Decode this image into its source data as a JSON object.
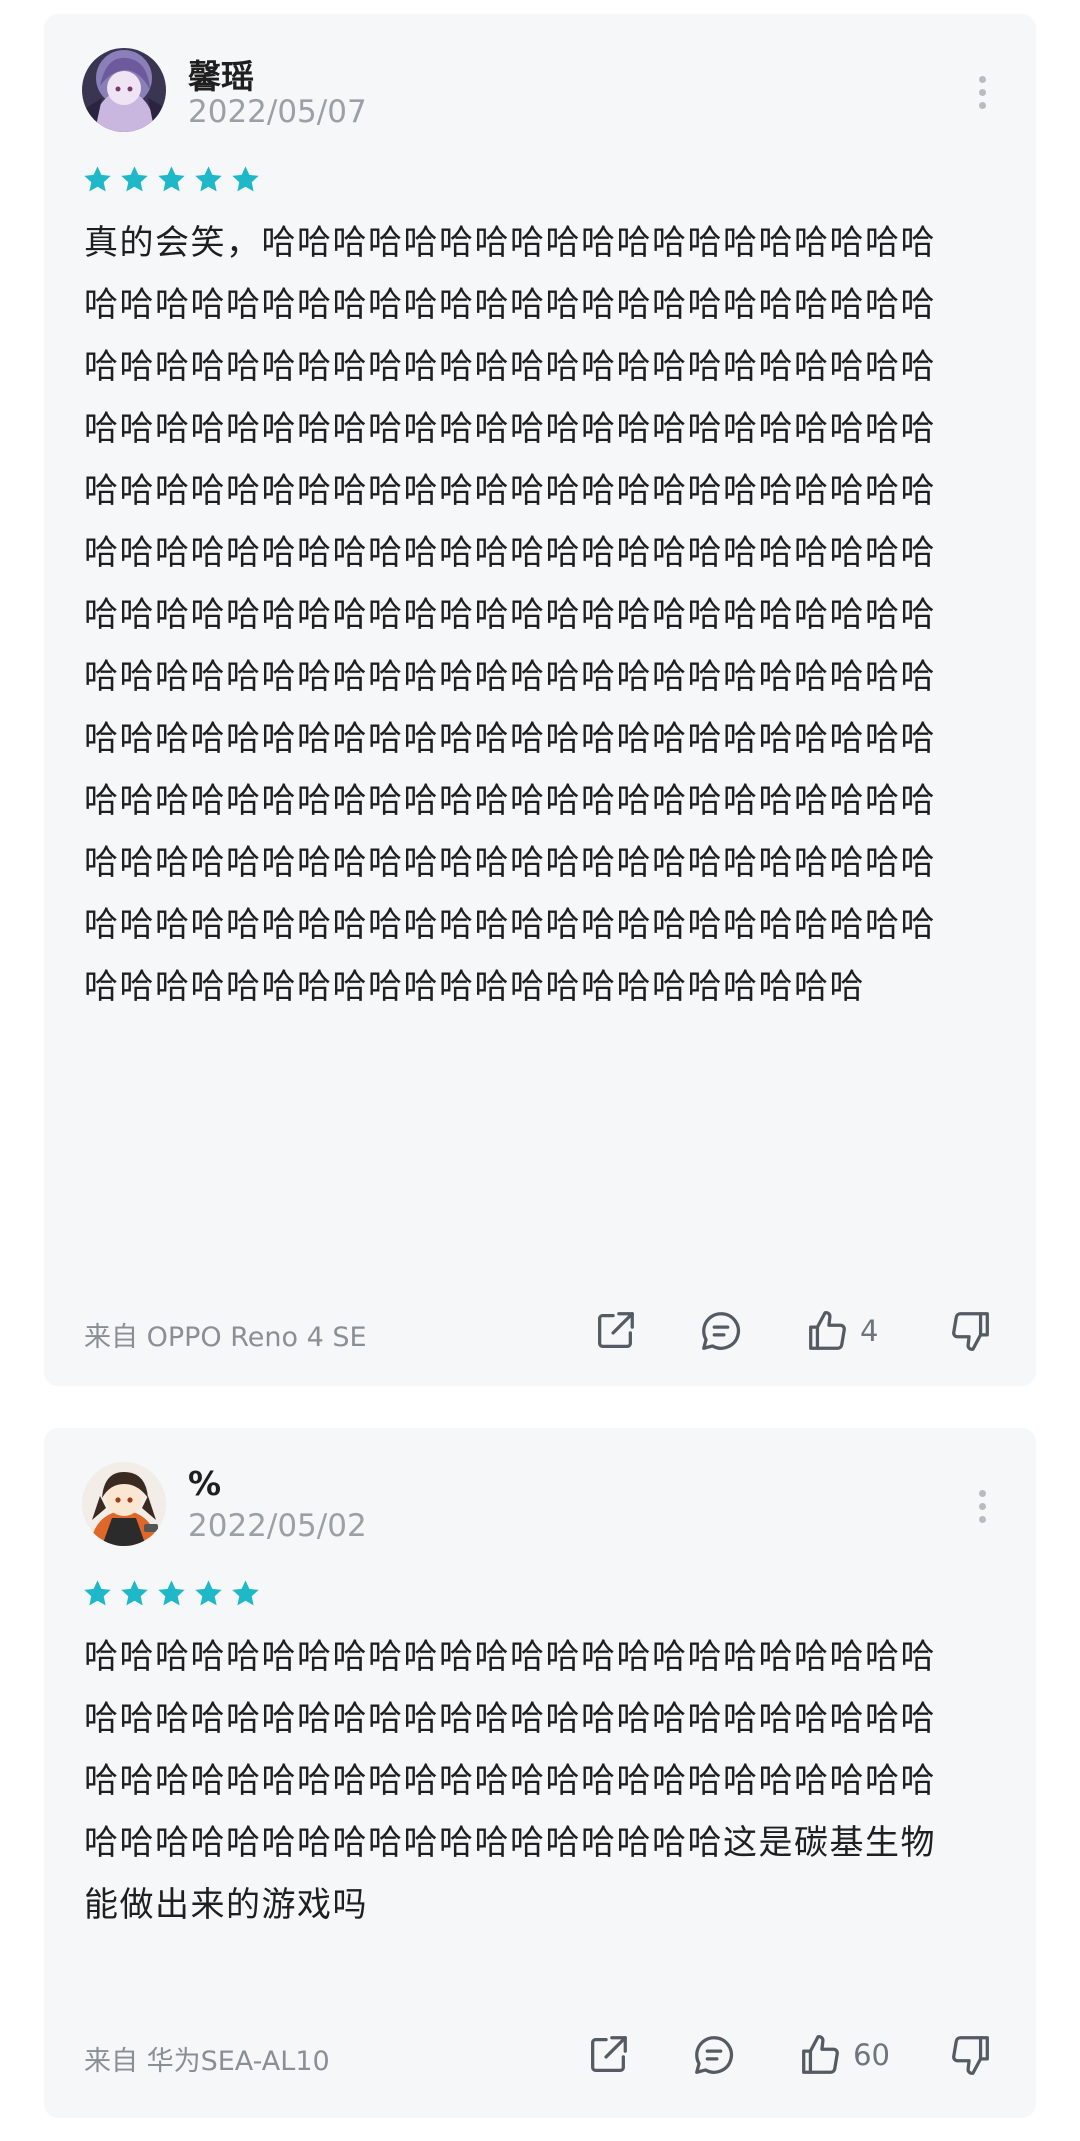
{
  "colors": {
    "card_bg": "#f5f7f9",
    "star": "#1fb8c9",
    "icon": "#555b62",
    "muted_text": "#9aa0a6"
  },
  "reviews": [
    {
      "username": "馨瑶",
      "date": "2022/05/07",
      "rating": 5,
      "text": "真的会笑，哈哈哈哈哈哈哈哈哈哈哈哈哈哈哈哈哈哈哈哈哈哈哈哈哈哈哈哈哈哈哈哈哈哈哈哈哈哈哈哈哈哈哈哈哈哈哈哈哈哈哈哈哈哈哈哈哈哈哈哈哈哈哈哈哈哈哈哈哈哈哈哈哈哈哈哈哈哈哈哈哈哈哈哈哈哈哈哈哈哈哈哈哈哈哈哈哈哈哈哈哈哈哈哈哈哈哈哈哈哈哈哈哈哈哈哈哈哈哈哈哈哈哈哈哈哈哈哈哈哈哈哈哈哈哈哈哈哈哈哈哈哈哈哈哈哈哈哈哈哈哈哈哈哈哈哈哈哈哈哈哈哈哈哈哈哈哈哈哈哈哈哈哈哈哈哈哈哈哈哈哈哈哈哈哈哈哈哈哈哈哈哈哈哈哈哈哈哈哈哈哈哈哈哈哈哈哈哈哈哈哈哈哈哈哈哈哈哈哈哈哈哈哈哈哈哈哈哈哈哈哈哈哈哈哈哈哈哈哈哈哈哈哈哈哈哈哈哈哈哈哈哈哈哈哈哈哈哈哈哈哈哈哈哈哈哈哈哈哈哈哈哈哈哈哈哈哈哈哈哈哈哈哈哈哈哈哈哈哈哈哈哈哈哈哈哈哈哈哈哈哈哈哈哈哈",
      "device": "来自 OPPO Reno 4 SE",
      "likes": "4",
      "avatar_icon": "anime-avatar-purple"
    },
    {
      "username": "%",
      "date": "2022/05/02",
      "rating": 5,
      "text": "哈哈哈哈哈哈哈哈哈哈哈哈哈哈哈哈哈哈哈哈哈哈哈哈哈哈哈哈哈哈哈哈哈哈哈哈哈哈哈哈哈哈哈哈哈哈哈哈哈哈哈哈哈哈哈哈哈哈哈哈哈哈哈哈哈哈哈哈哈哈哈哈哈哈哈哈哈哈哈哈哈哈哈哈哈哈哈哈哈哈这是碳基生物能做出来的游戏吗",
      "device": "来自 华为SEA-AL10",
      "likes": "60",
      "avatar_icon": "anime-avatar-orange"
    }
  ]
}
